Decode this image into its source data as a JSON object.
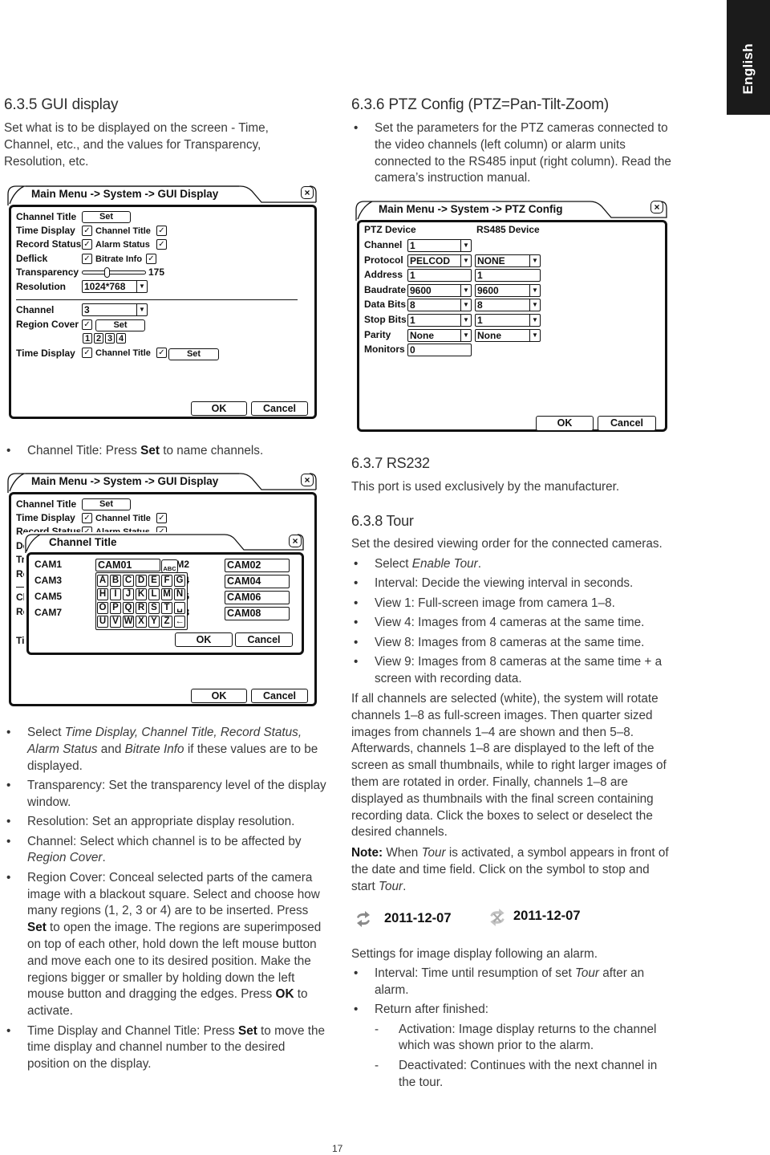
{
  "side_tab": {
    "label": "English"
  },
  "left": {
    "heading": "6.3.5 GUI display",
    "intro": "Set what is to be displayed on the screen - Time, Channel, etc., and the values for Transparency, Resolution, etc.",
    "bullet_channel_title": [
      {
        "t": "Channel Title: Press "
      },
      {
        "t": "Set",
        "s": "b"
      },
      {
        "t": " to name channels."
      }
    ],
    "bullets": [
      [
        {
          "t": "Select "
        },
        {
          "t": "Time Display, Channel Title, Record Status, Alarm Status",
          "s": "i"
        },
        {
          "t": " and "
        },
        {
          "t": "Bitrate Info",
          "s": "i"
        },
        {
          "t": " if these values are to be displayed."
        }
      ],
      [
        {
          "t": "Transparency: Set the transparency level of the display window."
        }
      ],
      [
        {
          "t": "Resolution: Set an appropriate display resolution."
        }
      ],
      [
        {
          "t": "Channel: Select which channel is to be affected by "
        },
        {
          "t": "Region Cover",
          "s": "i"
        },
        {
          "t": "."
        }
      ],
      [
        {
          "t": "Region Cover: Conceal selected parts of the camera image with a blackout square. Select and choose how many regions (1, 2, 3 or 4) are to be inserted. Press "
        },
        {
          "t": "Set",
          "s": "b"
        },
        {
          "t": " to open the image. The regions are superimposed on top of each other, hold down the left mouse button and move each one to its desired position. Make the regions bigger or smaller by holding down the left mouse button and dragging the edges. Press "
        },
        {
          "t": "OK",
          "s": "b"
        },
        {
          "t": " to activate."
        }
      ],
      [
        {
          "t": "Time Display and Channel Title: Press "
        },
        {
          "t": "Set",
          "s": "b"
        },
        {
          "t": " to move the time display and channel number to the desired position on the display."
        }
      ]
    ]
  },
  "gui_dialog": {
    "title": "Main Menu -> System -> GUI Display",
    "channel_title_label": "Channel Title",
    "set": "Set",
    "time_display": "Time Display",
    "channel_title": "Channel Title",
    "record_status": "Record Status",
    "alarm_status": "Alarm Status",
    "deflick": "Deflick",
    "bitrate_info": "Bitrate Info",
    "transparency": "Transparency",
    "transparency_value": "175",
    "resolution": "Resolution",
    "resolution_value": "1024*768",
    "channel": "Channel",
    "channel_value": "3",
    "region_cover": "Region Cover",
    "regions": [
      "1",
      "2",
      "3",
      "4"
    ],
    "check": "✓",
    "dropdown": "▼",
    "close": "×",
    "ok": "OK",
    "cancel": "Cancel"
  },
  "channel_title_dialog": {
    "title": "Channel Title",
    "cameras_left": [
      {
        "label": "CAM1",
        "value": "CAM01"
      },
      {
        "label": "CAM3"
      },
      {
        "label": "CAM5"
      },
      {
        "label": "CAM7"
      }
    ],
    "cameras_right": [
      {
        "label": "CAM2",
        "value": "CAM02"
      },
      {
        "label": "CAM4",
        "value": "CAM04"
      },
      {
        "label": "CAM6",
        "value": "CAM06"
      },
      {
        "label": "CAM8",
        "value": "CAM08"
      }
    ],
    "abc": "ABC",
    "keys": [
      "A",
      "B",
      "C",
      "D",
      "E",
      "F",
      "G",
      "H",
      "I",
      "J",
      "K",
      "L",
      "M",
      "N",
      "O",
      "P",
      "Q",
      "R",
      "S",
      "T",
      "␣",
      "U",
      "V",
      "W",
      "X",
      "Y",
      "Z",
      "←"
    ],
    "ok": "OK",
    "cancel": "Cancel"
  },
  "right": {
    "heading": "6.3.6 PTZ Config (PTZ=Pan-Tilt-Zoom)",
    "ptz_bullet": "Set the parameters for the PTZ cameras connected to the video channels (left column) or alarm units connected to the RS485 input (right column). Read the camera’s instruction manual.",
    "rs232_heading": "6.3.7 RS232",
    "rs232_text": "This port is used exclusively by the manufacturer.",
    "tour_heading": "6.3.8 Tour",
    "tour_intro": "Set the desired viewing order for the connected cameras.",
    "tour_bullets": [
      [
        {
          "t": "Select "
        },
        {
          "t": "Enable Tour",
          "s": "i"
        },
        {
          "t": "."
        }
      ],
      [
        {
          "t": "Interval: Decide the viewing interval in seconds."
        }
      ],
      [
        {
          "t": "View 1: Full-screen image from camera 1–8."
        }
      ],
      [
        {
          "t": "View 4: Images from 4 cameras at the same time."
        }
      ],
      [
        {
          "t": "View 8: Images from 8 cameras at the same time."
        }
      ],
      [
        {
          "t": "View 9: Images from 8 cameras at the same time + a screen with recording data."
        }
      ]
    ],
    "tour_paragraph": "If all channels are selected (white), the system will rotate channels 1–8 as full-screen images. Then quarter sized images from channels 1–4 are shown and then 5–8. Afterwards, channels 1–8 are displayed to the left of the screen as small thumbnails, while to right larger images of them are rotated in order. Finally, channels 1–8 are displayed as thumbnails with the final screen containing recording data. Click the boxes to select or deselect the desired channels.",
    "note": [
      {
        "t": "Note:",
        "s": "b"
      },
      {
        "t": " When "
      },
      {
        "t": "Tour",
        "s": "i"
      },
      {
        "t": " is activated, a symbol appears in front of the date and time field. Click on the symbol to stop and start "
      },
      {
        "t": "Tour",
        "s": "i"
      },
      {
        "t": "."
      }
    ],
    "tour_symbols": [
      {
        "icon": "tour-active-icon",
        "date": "2011-12-07"
      },
      {
        "icon": "tour-inactive-icon",
        "date": "2011-12-07"
      }
    ],
    "alarm_intro": "Settings for image display following an alarm.",
    "alarm_bullets": [
      [
        {
          "t": "Interval: Time until resumption of set "
        },
        {
          "t": "Tour",
          "s": "i"
        },
        {
          "t": " after an alarm."
        }
      ],
      [
        {
          "t": "Return after finished:"
        }
      ]
    ],
    "dash": "-",
    "alarm_sub": [
      [
        {
          "t": "Activation: Image display returns to the channel which was shown prior to the alarm."
        }
      ],
      [
        {
          "t": "Deactivated: Continues with the next channel in the tour."
        }
      ]
    ]
  },
  "ptz_dialog": {
    "title": "Main Menu -> System -> PTZ Config",
    "ptz_device": "PTZ Device",
    "rs485_device": "RS485 Device",
    "rows": [
      {
        "label": "Channel",
        "ptz": "1",
        "ptz_kind": "select"
      },
      {
        "label": "Protocol",
        "ptz": "PELCOD",
        "ptz_kind": "select",
        "rs485": "NONE",
        "rs485_kind": "select"
      },
      {
        "label": "Address",
        "ptz": "1",
        "ptz_kind": "input",
        "rs485": "1",
        "rs485_kind": "input"
      },
      {
        "label": "Baudrate",
        "ptz": "9600",
        "ptz_kind": "select",
        "rs485": "9600",
        "rs485_kind": "select"
      },
      {
        "label": "Data Bits",
        "ptz": "8",
        "ptz_kind": "select",
        "rs485": "8",
        "rs485_kind": "select"
      },
      {
        "label": "Stop Bits",
        "ptz": "1",
        "ptz_kind": "select",
        "rs485": "1",
        "rs485_kind": "select"
      },
      {
        "label": "Parity",
        "ptz": "None",
        "ptz_kind": "select",
        "rs485": "None",
        "rs485_kind": "select"
      },
      {
        "label": "Monitors",
        "ptz": "0",
        "ptz_kind": "input"
      }
    ],
    "dropdown": "▼",
    "close": "×",
    "ok": "OK",
    "cancel": "Cancel"
  },
  "page_number": "17"
}
